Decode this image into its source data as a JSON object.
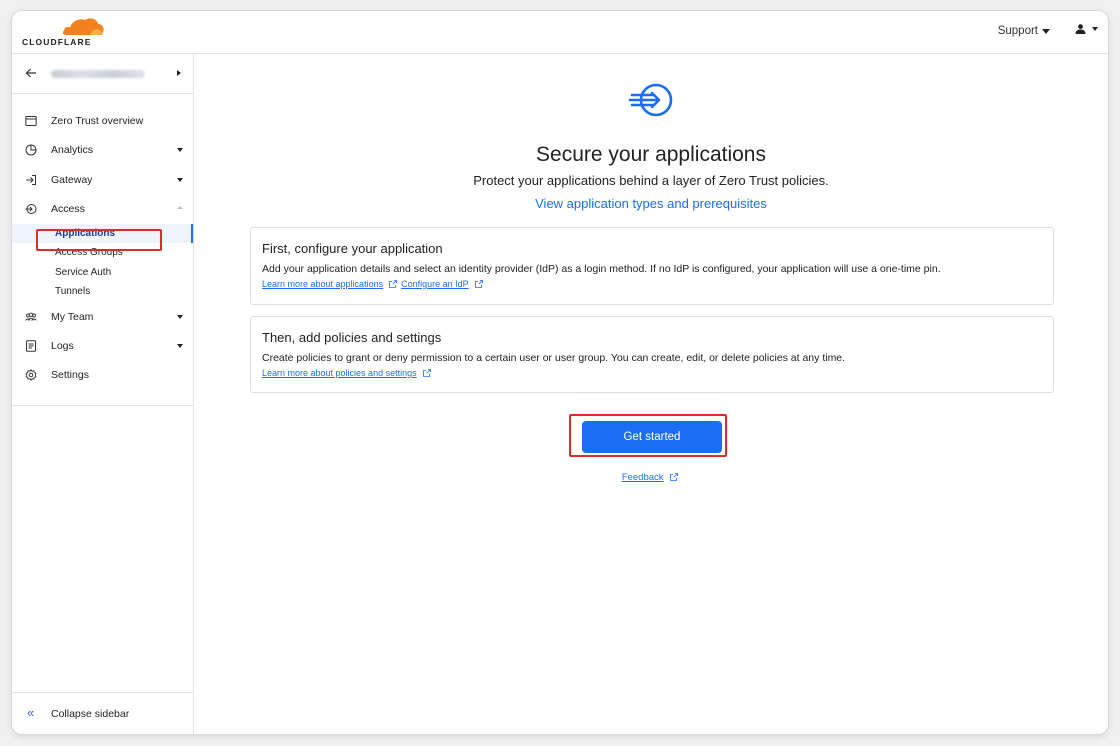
{
  "brand": {
    "logo_text": "CLOUDFLARE",
    "accent": "#f48120",
    "link_color": "#1b6ef3",
    "highlight": "#e02b2b"
  },
  "header": {
    "support_label": "Support",
    "user_icon": "user-icon"
  },
  "sidebar": {
    "account_name_blurred": true,
    "items": [
      {
        "label": "Zero Trust overview",
        "icon": "browser-window-icon",
        "has_dropdown": false
      },
      {
        "label": "Analytics",
        "icon": "pie-chart-icon",
        "has_dropdown": true
      },
      {
        "label": "Gateway",
        "icon": "gateway-icon",
        "has_dropdown": true
      },
      {
        "label": "Access",
        "icon": "access-icon",
        "expanded": true,
        "children": [
          {
            "label": "Applications",
            "active": true
          },
          {
            "label": "Access Groups"
          },
          {
            "label": "Service Auth"
          },
          {
            "label": "Tunnels"
          }
        ]
      },
      {
        "label": "My Team",
        "icon": "team-icon",
        "has_dropdown": true
      },
      {
        "label": "Logs",
        "icon": "logs-icon",
        "has_dropdown": true
      },
      {
        "label": "Settings",
        "icon": "gear-icon",
        "has_dropdown": false
      }
    ],
    "collapse_label": "Collapse sidebar"
  },
  "main": {
    "title": "Secure your applications",
    "subtitle": "Protect your applications behind a layer of Zero Trust policies.",
    "link": "View application types and prerequisites",
    "cards": [
      {
        "title": "First, configure your application",
        "description": "Add your application details and select an identity provider (IdP) as a login method. If no IdP is configured, your application will use a one-time pin.",
        "links": [
          "Learn more about applications",
          "Configure an IdP"
        ]
      },
      {
        "title": "Then, add policies and settings",
        "description": "Create policies to grant or deny permission to a certain user or user group. You can create, edit, or delete policies at any time.",
        "links": [
          "Learn more about policies and settings"
        ]
      }
    ],
    "cta_label": "Get started",
    "feedback_label": "Feedback"
  }
}
